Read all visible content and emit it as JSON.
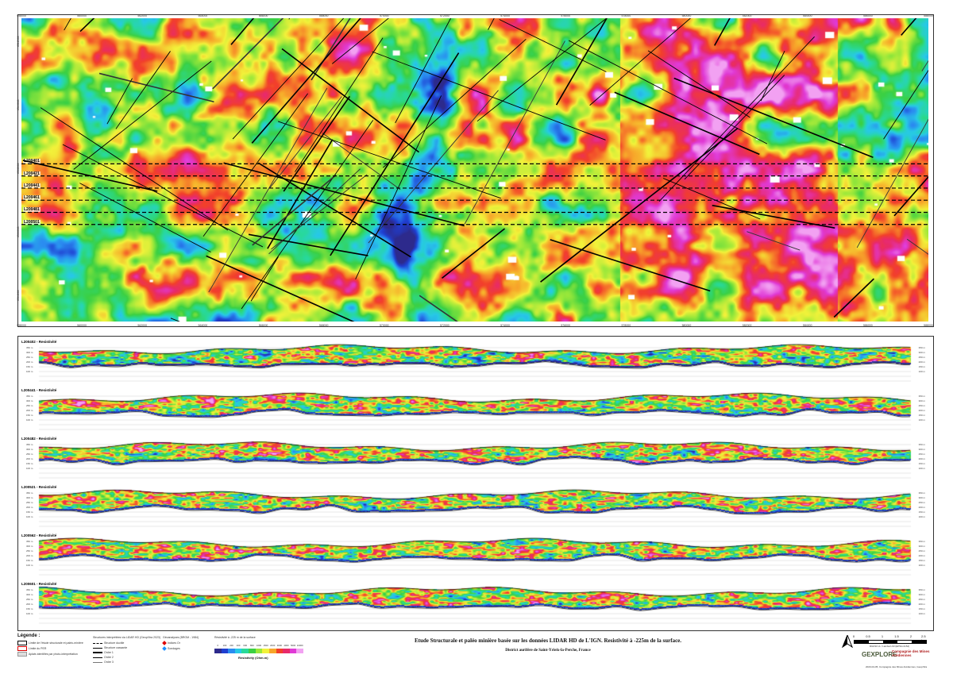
{
  "map": {
    "x_ticks": [
      "558000",
      "560000",
      "562000",
      "564000",
      "566000",
      "568000",
      "570000",
      "572000",
      "574000",
      "576000",
      "578000",
      "580000",
      "582000",
      "584000",
      "586000",
      "588000"
    ],
    "y_ticks": [
      "6512000",
      "6510000",
      "6508000",
      "6506000",
      "6504000"
    ],
    "survey_lines": [
      {
        "label": "L200401",
        "y_frac": 0.48
      },
      {
        "label": "L200421",
        "y_frac": 0.52
      },
      {
        "label": "L200441",
        "y_frac": 0.56
      },
      {
        "label": "L200461",
        "y_frac": 0.6
      },
      {
        "label": "L200481",
        "y_frac": 0.64
      },
      {
        "label": "L200501",
        "y_frac": 0.68
      }
    ]
  },
  "sections": [
    {
      "title": "L200402 - Resistivité",
      "depths_left": [
        "350 m",
        "300 m",
        "250 m",
        "200 m",
        "150 m",
        "100 m"
      ],
      "depths_right": [
        "350 m",
        "300 m",
        "250 m",
        "200 m",
        "150 m",
        "100 m"
      ]
    },
    {
      "title": "L200441 - Resistivité",
      "depths_left": [
        "350 m",
        "300 m",
        "250 m",
        "200 m",
        "150 m",
        "100 m"
      ],
      "depths_right": [
        "350 m",
        "300 m",
        "250 m",
        "200 m",
        "150 m",
        "100 m"
      ]
    },
    {
      "title": "L200482 - Resistivité",
      "depths_left": [
        "350 m",
        "300 m",
        "250 m",
        "200 m",
        "150 m",
        "100 m"
      ],
      "depths_right": [
        "350 m",
        "300 m",
        "250 m",
        "200 m",
        "150 m",
        "100 m"
      ]
    },
    {
      "title": "L200521 - Resistivité",
      "depths_left": [
        "350 m",
        "300 m",
        "250 m",
        "200 m",
        "150 m",
        "100 m"
      ],
      "depths_right": [
        "350 m",
        "300 m",
        "250 m",
        "200 m",
        "150 m",
        "100 m"
      ]
    },
    {
      "title": "L200562 - Resistivité",
      "depths_left": [
        "350 m",
        "300 m",
        "250 m",
        "200 m",
        "150 m",
        "100 m"
      ],
      "depths_right": [
        "350 m",
        "300 m",
        "250 m",
        "200 m",
        "150 m",
        "100 m"
      ]
    },
    {
      "title": "L200601 - Resistivité",
      "depths_left": [
        "350 m",
        "300 m",
        "250 m",
        "200 m",
        "150 m",
        "100 m"
      ],
      "depths_right": [
        "350 m",
        "300 m",
        "250 m",
        "200 m",
        "150 m",
        "100 m"
      ]
    }
  ],
  "legend": {
    "title": "Légende :",
    "items": [
      "Limite de l'étude structurale et paléo-minière",
      "Limite du PER",
      "Aplats identifiés par photo-interprétation"
    ],
    "structures_title": "Structures interprétées via LiDAR HD (GeopXtra 2023)",
    "structures": [
      "Structure ductile",
      "Structure cassante",
      "Ordre 1",
      "Ordre 2",
      "Ordre 3"
    ],
    "geo_title": "Géoanalyses (BRGM - 1984)",
    "geo": [
      "Indices Or",
      "Sondages"
    ],
    "res_title": "Résistivité à -225 m de la surface",
    "colorbar_ticks": [
      "0",
      "100",
      "200",
      "400",
      "600",
      "800",
      "1000",
      "1500",
      "2000",
      "3000",
      "4000",
      "5000",
      "10000"
    ],
    "colorbar_label": "Resistivity (Ohm.m)",
    "colors": [
      "#2d2a8c",
      "#1f3fd1",
      "#2a8cf0",
      "#27c9e6",
      "#28d99a",
      "#3bd043",
      "#9be83a",
      "#f2f23a",
      "#f7a62a",
      "#f2402a",
      "#e82a6a",
      "#e03ad6",
      "#f2a2f2"
    ]
  },
  "title": {
    "main": "Etude Structurale et paléo minière basée sur les données LIDAR HD de L'IGN. Resistivité à -225m de la surface.",
    "sub": "District aurifère de Saint-Yrieix-la-Perche, France"
  },
  "scale": {
    "labels": [
      "0",
      "0.5",
      "1",
      "1.5",
      "2",
      "2.5 km"
    ]
  },
  "projection": "RGF93 v1 / Lambert-93 (EPSG:2154)",
  "logos": {
    "a": "GEXPLORE",
    "b": "Compagnie des Mines Arédiennes"
  },
  "credits": "2023-04-05, Compagnie des Mines Arédiennes, GeopXtra"
}
